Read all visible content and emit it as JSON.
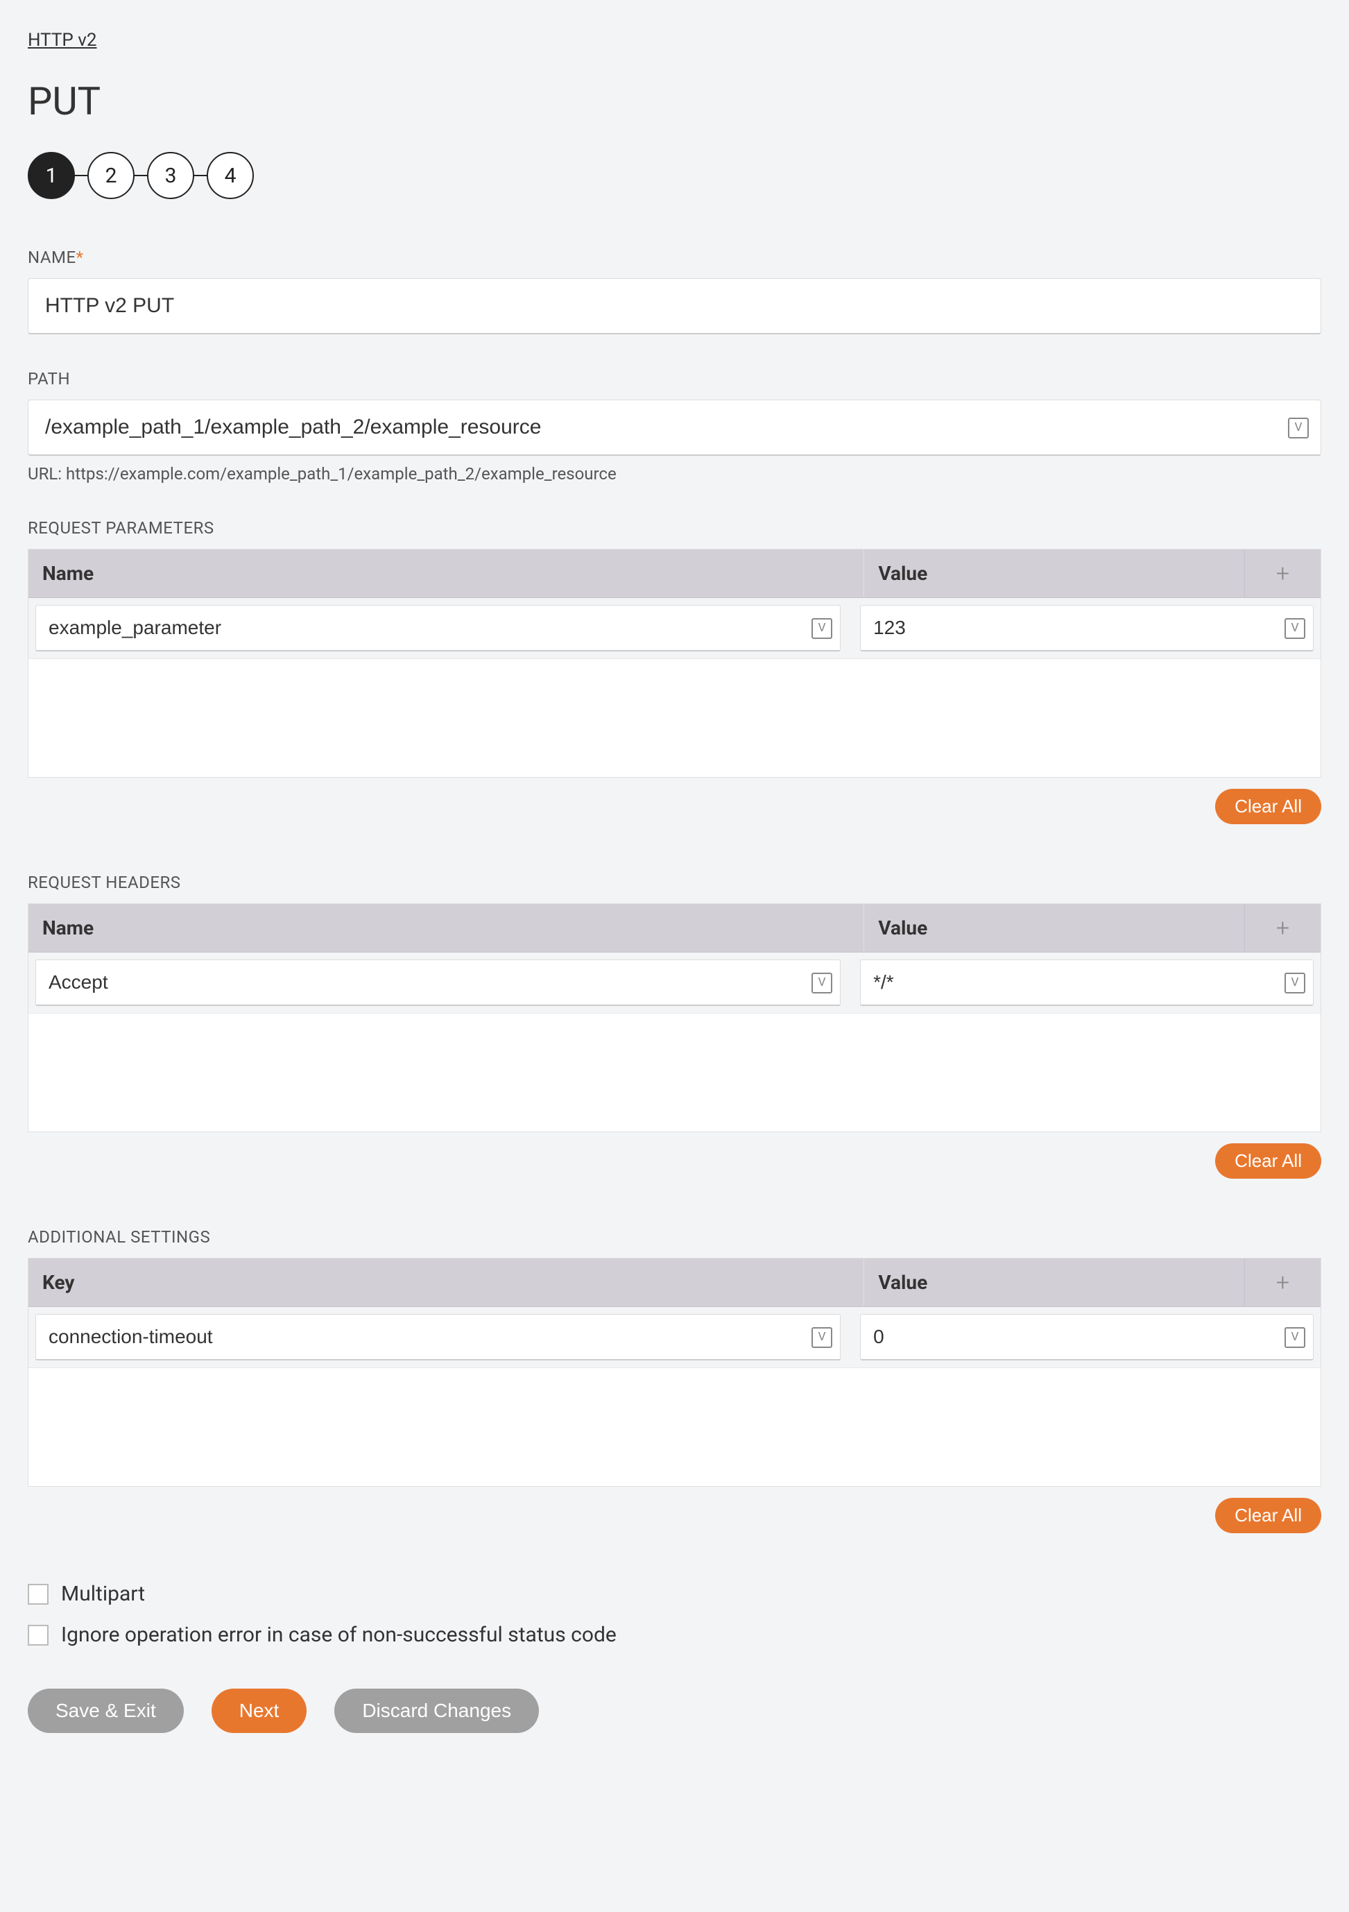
{
  "breadcrumb": "HTTP v2",
  "page_title": "PUT",
  "stepper": {
    "steps": [
      "1",
      "2",
      "3",
      "4"
    ],
    "active": 0
  },
  "name_field": {
    "label": "NAME",
    "required_mark": "*",
    "value": "HTTP v2 PUT"
  },
  "path_field": {
    "label": "PATH",
    "value": "/example_path_1/example_path_2/example_resource",
    "helper_prefix": "URL: ",
    "helper_url": "https://example.com/example_path_1/example_path_2/example_resource",
    "var_icon": "V"
  },
  "request_parameters": {
    "label": "REQUEST PARAMETERS",
    "columns": {
      "name": "Name",
      "value": "Value"
    },
    "add_icon": "+",
    "rows": [
      {
        "name": "example_parameter",
        "value": "123"
      }
    ],
    "clear_label": "Clear All",
    "var_icon": "V"
  },
  "request_headers": {
    "label": "REQUEST HEADERS",
    "columns": {
      "name": "Name",
      "value": "Value"
    },
    "add_icon": "+",
    "rows": [
      {
        "name": "Accept",
        "value": "*/*"
      }
    ],
    "clear_label": "Clear All",
    "var_icon": "V"
  },
  "additional_settings": {
    "label": "ADDITIONAL SETTINGS",
    "columns": {
      "name": "Key",
      "value": "Value"
    },
    "add_icon": "+",
    "rows": [
      {
        "name": "connection-timeout",
        "value": "0"
      }
    ],
    "clear_label": "Clear All",
    "var_icon": "V"
  },
  "checkboxes": {
    "multipart": "Multipart",
    "ignore_error": "Ignore operation error in case of non-successful status code"
  },
  "footer": {
    "save_exit": "Save & Exit",
    "next": "Next",
    "discard": "Discard Changes"
  }
}
